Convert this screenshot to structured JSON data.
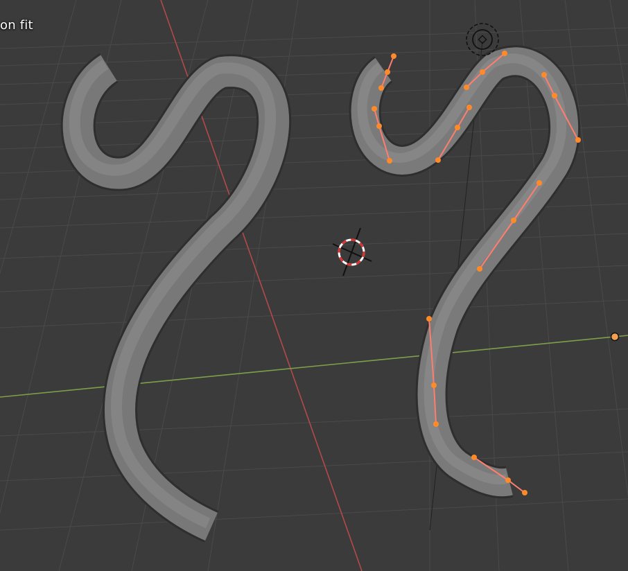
{
  "overlay": {
    "operator_text": "on fit"
  },
  "colors": {
    "background": "#3b3b3b",
    "grid_line": "#4a4a4a",
    "x_axis": "#b34a4a",
    "y_axis": "#7fa04a",
    "tube": "#7b7b7b",
    "control_point": "#ff8a2a",
    "handle_line": "#ff7e6e"
  },
  "scene": {
    "objects": [
      {
        "name": "curve-object-left",
        "selected": false,
        "in_edit_mode": false
      },
      {
        "name": "curve-object-right",
        "selected": true,
        "in_edit_mode": true
      }
    ],
    "cursor_3d": "3d-cursor-icon",
    "object_origin": "origin-icon",
    "light_gizmo": "light-gizmo-icon"
  }
}
